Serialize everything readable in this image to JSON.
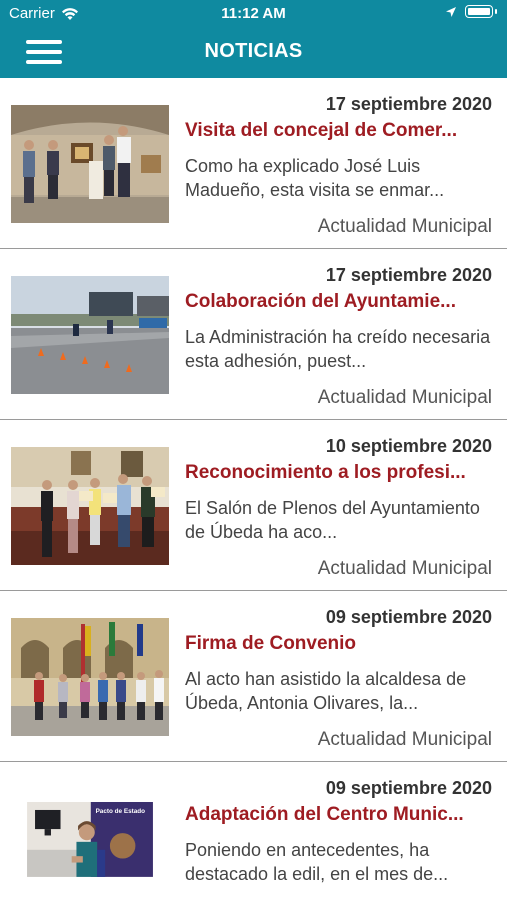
{
  "status_bar": {
    "carrier": "Carrier",
    "time": "11:12 AM"
  },
  "header": {
    "title": "NOTICIAS",
    "menu_icon": "hamburger-menu-icon"
  },
  "colors": {
    "header_bg": "#0f8aa0",
    "headline": "#9e1c22"
  },
  "news": [
    {
      "date": "17 septiembre 2020",
      "title": "Visita del concejal de Comer...",
      "summary": "Como ha explicado José Luis Madueño, esta visita se enmar...",
      "category": "Actualidad Municipal"
    },
    {
      "date": "17 septiembre 2020",
      "title": "Colaboración del Ayuntamie...",
      "summary": "La Administración ha creído necesaria esta adhesión, puest...",
      "category": "Actualidad Municipal"
    },
    {
      "date": "10 septiembre 2020",
      "title": "Reconocimiento a los profesi...",
      "summary": "El Salón de Plenos del Ayuntamiento de Úbeda ha aco...",
      "category": "Actualidad Municipal"
    },
    {
      "date": "09 septiembre 2020",
      "title": "Firma de Convenio",
      "summary": "Al acto han asistido la alcaldesa de Úbeda, Antonia Olivares, la...",
      "category": "Actualidad Municipal"
    },
    {
      "date": "09 septiembre 2020",
      "title": "Adaptación del Centro Munic...",
      "summary": "Poniendo en antecedentes, ha destacado la edil, en el mes de...",
      "category": "",
      "thumb_text_1": "Pacto de Estado"
    }
  ]
}
